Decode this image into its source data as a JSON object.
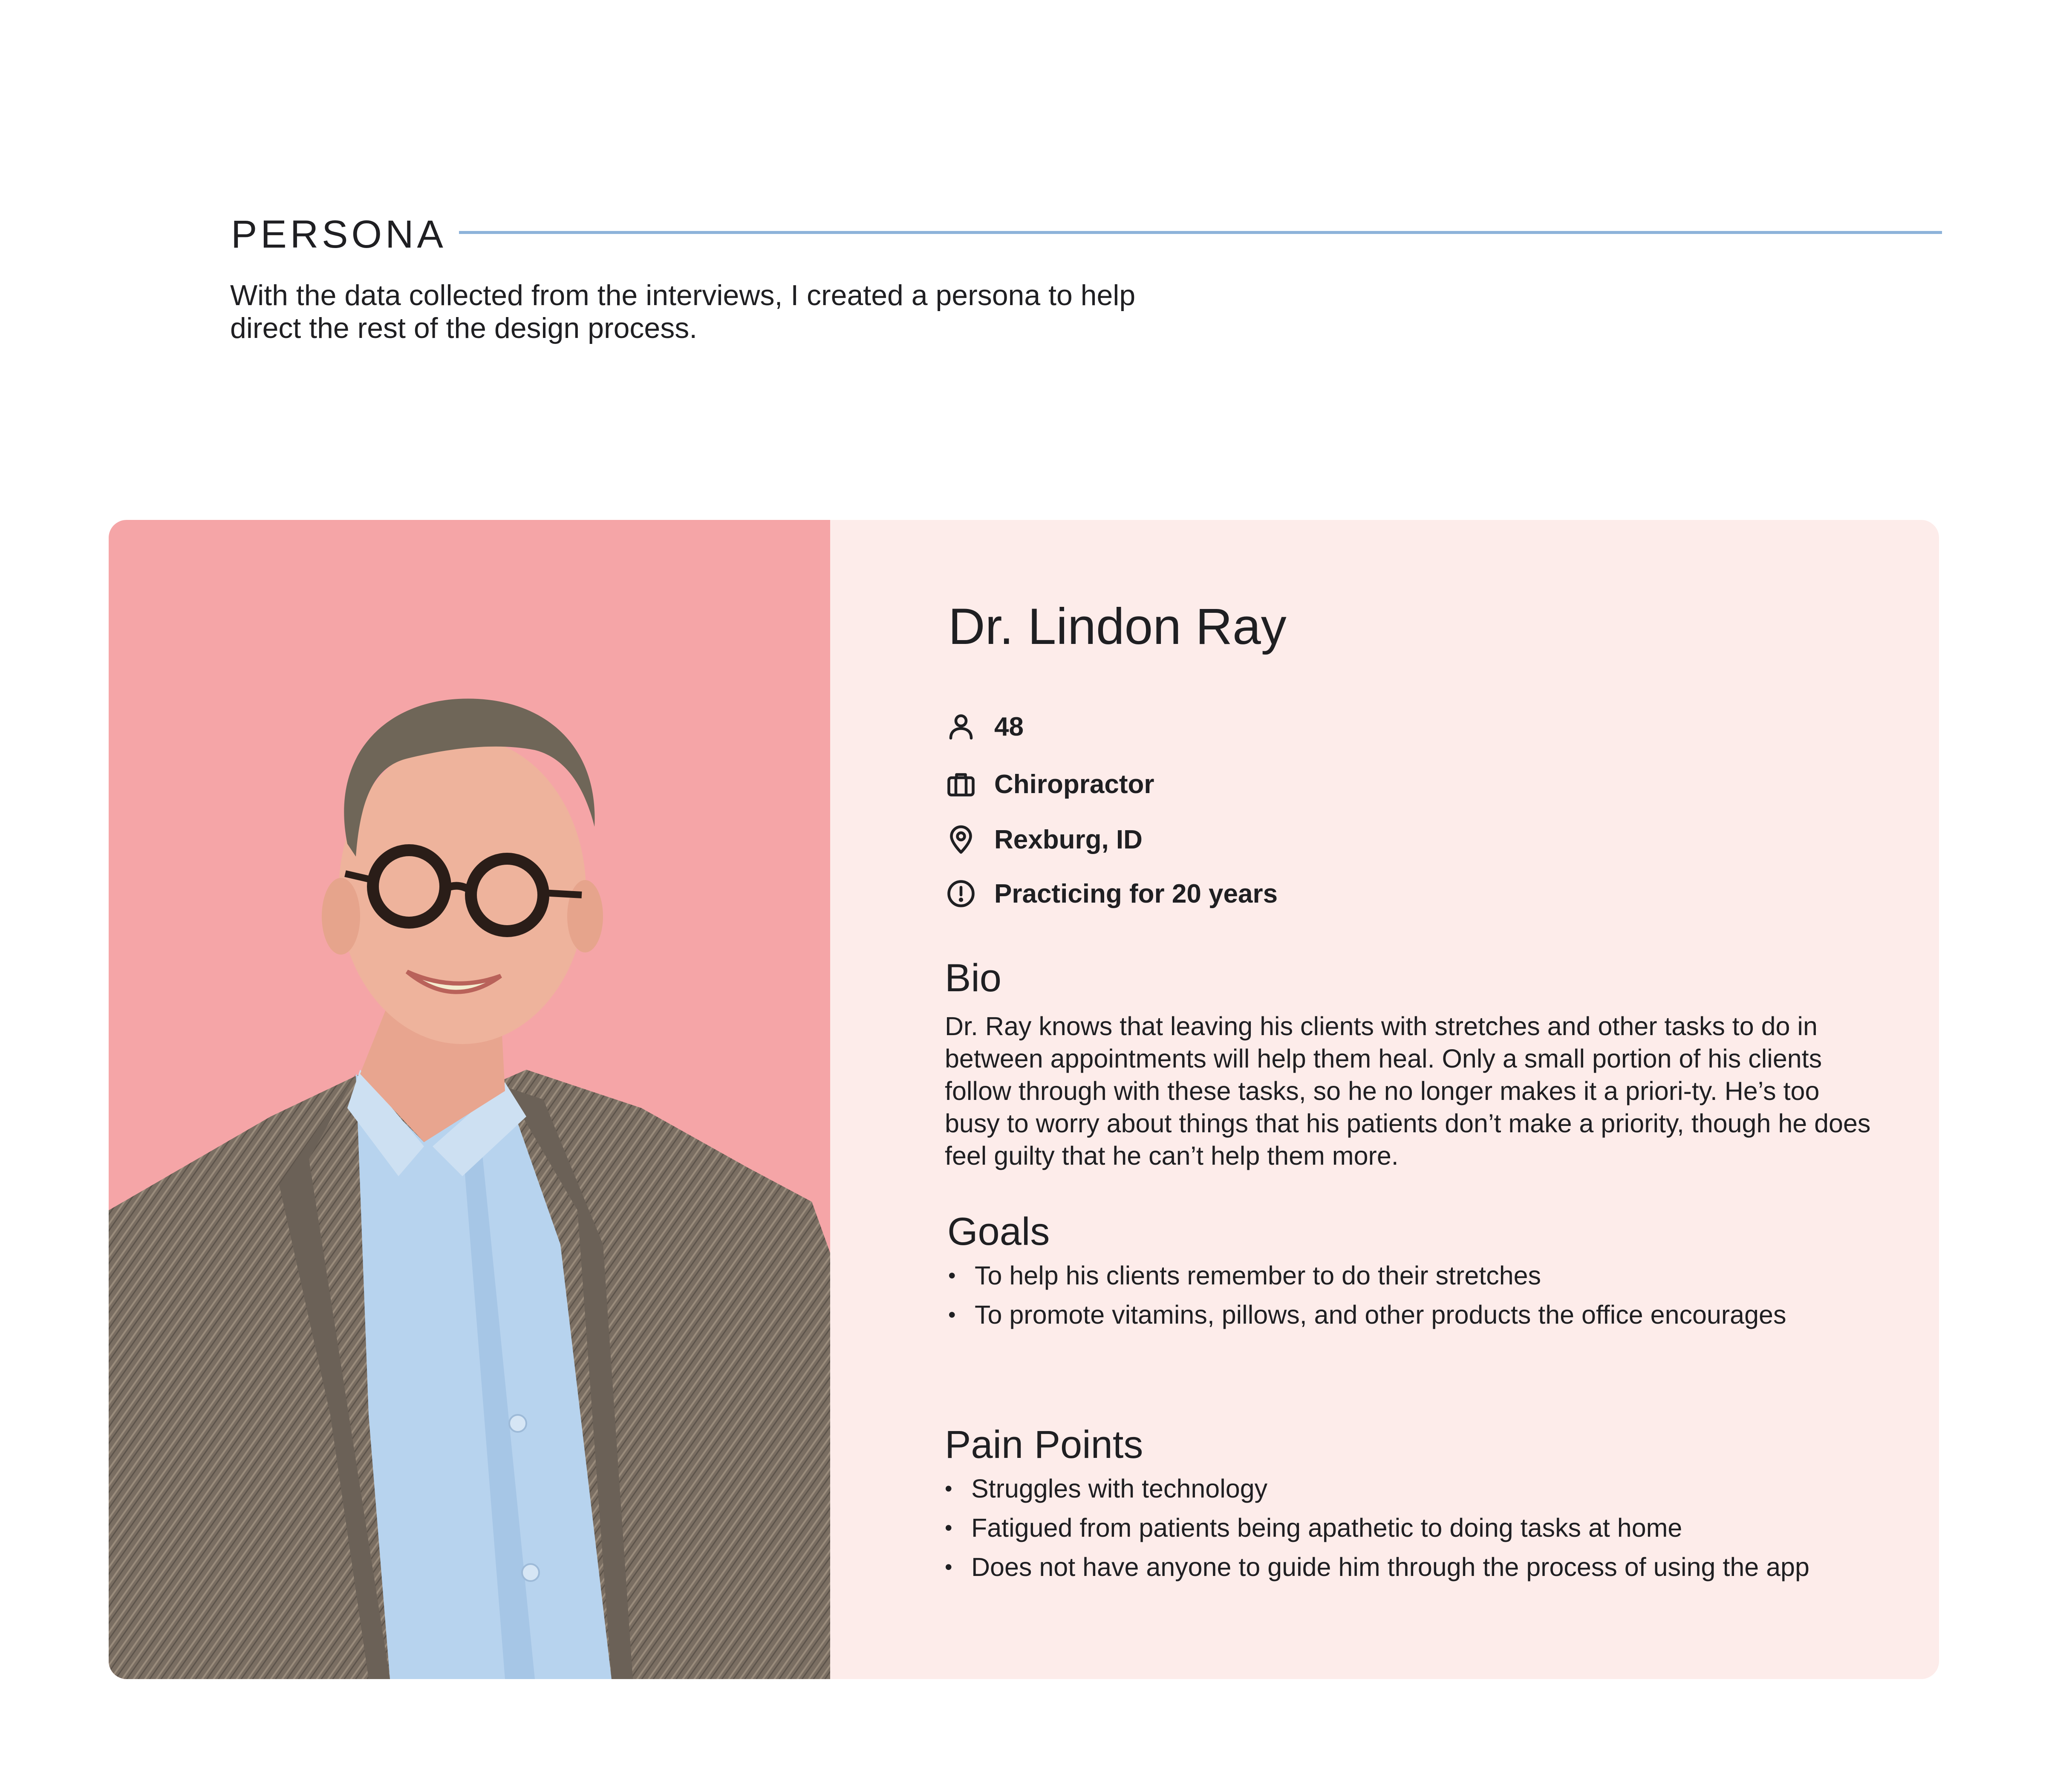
{
  "section": {
    "title": "PERSONA",
    "intro": "With the data collected from the interviews, I created a persona to help direct the rest of the design process."
  },
  "persona": {
    "name": "Dr. Lindon Ray",
    "facts": [
      {
        "icon": "person-icon",
        "label": "48"
      },
      {
        "icon": "briefcase-icon",
        "label": "Chiropractor"
      },
      {
        "icon": "location-pin-icon",
        "label": "Rexburg, ID"
      },
      {
        "icon": "alert-circle-icon",
        "label": "Practicing for 20 years"
      }
    ],
    "bio_heading": "Bio",
    "bio": "Dr. Ray knows that leaving his clients with stretches and other tasks to do in between appointments will help them heal. Only a small portion of his clients follow through with these tasks, so he no longer makes it a priori-ty. He’s too busy to worry about things that his patients don’t make a priority, though he does feel guilty that he can’t help them more.",
    "goals_heading": "Goals",
    "goals": [
      "To help his clients remember to do their stretches",
      "To promote vitamins, pillows, and other products the office encourages"
    ],
    "pain_heading": "Pain Points",
    "pain_points": [
      "Struggles with technology",
      "Fatigued from patients being apathetic to doing tasks at home",
      "Does not have anyone to guide him through the process of using the app"
    ]
  },
  "colors": {
    "accent_rule": "#8db3da",
    "photo_background": "#f5a5a7",
    "card_background": "#fdecea",
    "text": "#1f1f22"
  }
}
